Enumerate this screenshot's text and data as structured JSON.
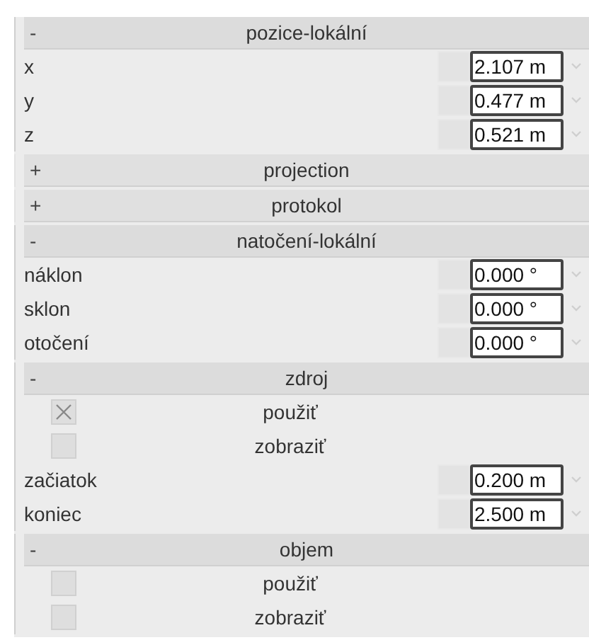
{
  "sections": [
    {
      "title": "pozice-lokální",
      "toggle": "-",
      "rows": [
        {
          "kind": "number",
          "label": "x",
          "value": "2.107 m"
        },
        {
          "kind": "number",
          "label": "y",
          "value": "0.477 m"
        },
        {
          "kind": "number",
          "label": "z",
          "value": "0.521 m"
        }
      ]
    },
    {
      "title": "projection",
      "toggle": "+"
    },
    {
      "title": "protokol",
      "toggle": "+"
    },
    {
      "title": "natočení-lokální",
      "toggle": "-",
      "rows": [
        {
          "kind": "number",
          "label": "náklon",
          "value": "0.000 °"
        },
        {
          "kind": "number",
          "label": "sklon",
          "value": "0.000 °"
        },
        {
          "kind": "number",
          "label": "otočení",
          "value": "0.000 °"
        }
      ]
    },
    {
      "title": "zdroj",
      "toggle": "-",
      "rows": [
        {
          "kind": "checkbox",
          "label": "použiť",
          "checked": true
        },
        {
          "kind": "checkbox",
          "label": "zobraziť",
          "checked": false
        },
        {
          "kind": "number",
          "label": "začiatok",
          "value": "0.200 m"
        },
        {
          "kind": "number",
          "label": "koniec",
          "value": "2.500 m"
        }
      ]
    },
    {
      "title": "objem",
      "toggle": "-",
      "rows": [
        {
          "kind": "checkbox",
          "label": "použiť",
          "checked": false
        },
        {
          "kind": "checkbox",
          "label": "zobraziť",
          "checked": false
        }
      ]
    }
  ]
}
